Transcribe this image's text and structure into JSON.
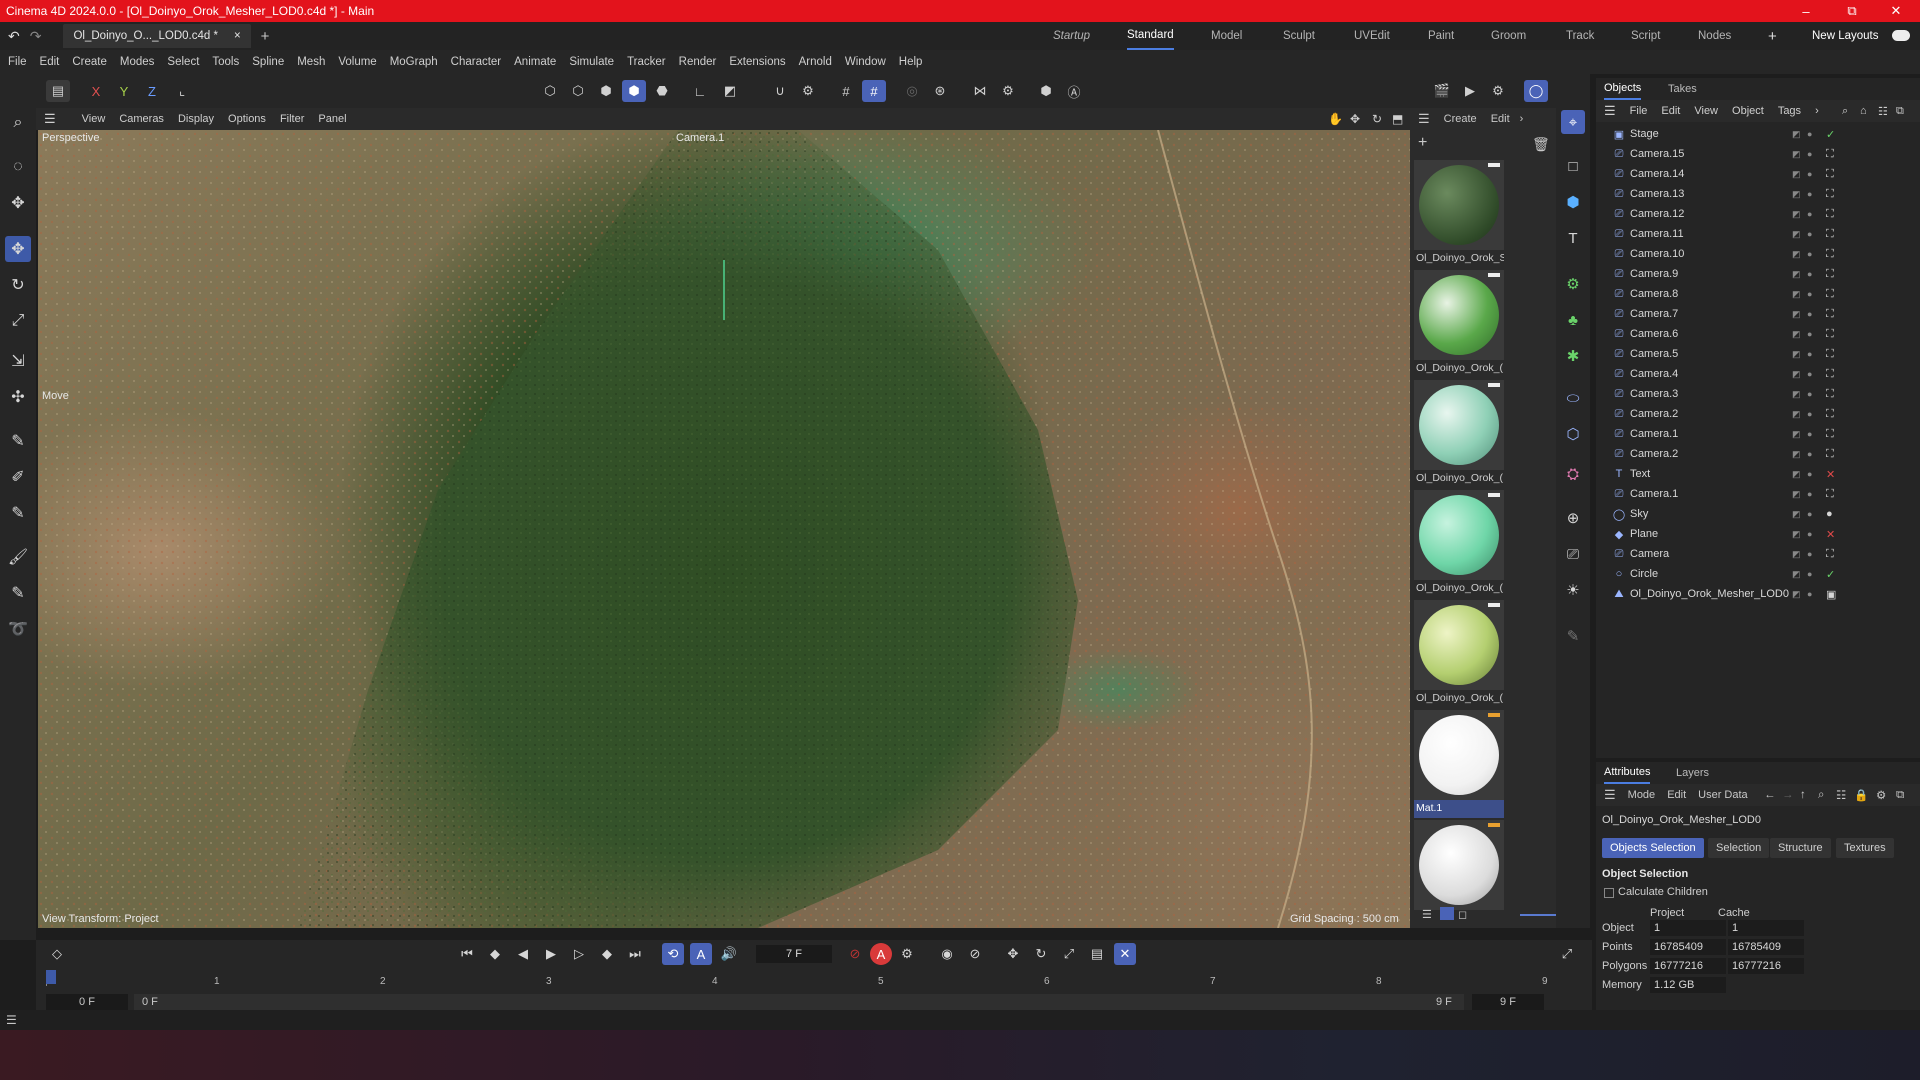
{
  "window": {
    "title": "Cinema 4D 2024.0.0 - [Ol_Doinyo_Orok_Mesher_LOD0.c4d *] - Main",
    "minimize": "–",
    "maximize": "⧉",
    "close": "✕"
  },
  "doc_tab": {
    "label": "Ol_Doinyo_O..._LOD0.c4d *",
    "close": "×",
    "add": "+"
  },
  "layouts": {
    "items": [
      "Startup",
      "Standard",
      "Model",
      "Sculpt",
      "UVEdit",
      "Paint",
      "Groom",
      "Track",
      "Script",
      "Nodes"
    ],
    "active": "Standard",
    "add": "+",
    "new_layouts": "New Layouts"
  },
  "menu": [
    "File",
    "Edit",
    "Create",
    "Modes",
    "Select",
    "Tools",
    "Spline",
    "Mesh",
    "Volume",
    "MoGraph",
    "Character",
    "Animate",
    "Simulate",
    "Tracker",
    "Render",
    "Extensions",
    "Arnold",
    "Window",
    "Help"
  ],
  "axes": {
    "x": "X",
    "y": "Y",
    "z": "Z"
  },
  "viewport": {
    "menu": [
      "View",
      "Cameras",
      "Display",
      "Options",
      "Filter",
      "Panel"
    ],
    "view_name": "Perspective",
    "camera": "Camera.1",
    "tool": "Move",
    "transform": "View Transform: Project",
    "grid": "Grid Spacing : 500 cm"
  },
  "materials": {
    "menu": [
      "Create",
      "Edit"
    ],
    "items": [
      {
        "name": "Ol_Doinyo_Orok_S",
        "color": "#3f5a36"
      },
      {
        "name": "Ol_Doinyo_Orok_(",
        "color": "#5aa84a"
      },
      {
        "name": "Ol_Doinyo_Orok_(",
        "color": "#8fd0b6"
      },
      {
        "name": "Ol_Doinyo_Orok_(",
        "color": "#6fd6a8"
      },
      {
        "name": "Ol_Doinyo_Orok_(",
        "color": "#b4cf70"
      },
      {
        "name": "Mat.1",
        "color": "#ffffff"
      },
      {
        "name": "",
        "color": "#e6e6e6"
      }
    ]
  },
  "objects_panel": {
    "tabs": [
      "Objects",
      "Takes"
    ],
    "menu": [
      "File",
      "Edit",
      "View",
      "Object",
      "Tags"
    ],
    "items": [
      {
        "name": "Stage",
        "icon": "stage-icon",
        "tag": "✓"
      },
      {
        "name": "Camera.15",
        "icon": "camera-icon",
        "tag": "⛶"
      },
      {
        "name": "Camera.14",
        "icon": "camera-icon",
        "tag": "⛶"
      },
      {
        "name": "Camera.13",
        "icon": "camera-icon",
        "tag": "⛶"
      },
      {
        "name": "Camera.12",
        "icon": "camera-icon",
        "tag": "⛶"
      },
      {
        "name": "Camera.11",
        "icon": "camera-icon",
        "tag": "⛶"
      },
      {
        "name": "Camera.10",
        "icon": "camera-icon",
        "tag": "⛶"
      },
      {
        "name": "Camera.9",
        "icon": "camera-icon",
        "tag": "⛶"
      },
      {
        "name": "Camera.8",
        "icon": "camera-icon",
        "tag": "⛶"
      },
      {
        "name": "Camera.7",
        "icon": "camera-icon",
        "tag": "⛶"
      },
      {
        "name": "Camera.6",
        "icon": "camera-icon",
        "tag": "⛶"
      },
      {
        "name": "Camera.5",
        "icon": "camera-icon",
        "tag": "⛶"
      },
      {
        "name": "Camera.4",
        "icon": "camera-icon",
        "tag": "⛶"
      },
      {
        "name": "Camera.3",
        "icon": "camera-icon",
        "tag": "⛶"
      },
      {
        "name": "Camera.2",
        "icon": "camera-icon",
        "tag": "⛶"
      },
      {
        "name": "Camera.1",
        "icon": "camera-icon",
        "tag": "⛶"
      },
      {
        "name": "Camera.2",
        "icon": "camera-icon",
        "tag": "⛶"
      },
      {
        "name": "Text",
        "icon": "text-icon",
        "tag": "✕"
      },
      {
        "name": "Camera.1",
        "icon": "camera-icon",
        "tag": "⛶"
      },
      {
        "name": "Sky",
        "icon": "sky-icon",
        "tag": "●"
      },
      {
        "name": "Plane",
        "icon": "plane-icon",
        "tag": "✕"
      },
      {
        "name": "Camera",
        "icon": "camera-icon",
        "tag": "⛶"
      },
      {
        "name": "Circle",
        "icon": "circle-icon",
        "tag": "✓"
      },
      {
        "name": "Ol_Doinyo_Orok_Mesher_LOD0",
        "icon": "mesh-icon",
        "tag": "▣"
      }
    ]
  },
  "attributes": {
    "tabs": [
      "Attributes",
      "Layers"
    ],
    "menu": [
      "Mode",
      "Edit",
      "User Data"
    ],
    "object_name": "Ol_Doinyo_Orok_Mesher_LOD0",
    "subtabs": [
      "Objects Selection",
      "Selection",
      "Structure",
      "Textures"
    ],
    "section": "Object Selection",
    "calc_children": "Calculate Children",
    "col_project": "Project",
    "col_cache": "Cache",
    "rows": [
      {
        "label": "Object",
        "project": "1",
        "cache": "1"
      },
      {
        "label": "Points",
        "project": "16785409",
        "cache": "16785409"
      },
      {
        "label": "Polygons",
        "project": "16777216",
        "cache": "16777216"
      },
      {
        "label": "Memory",
        "project": "1.12 GB",
        "cache": ""
      }
    ]
  },
  "timeline": {
    "current_frame": "7 F",
    "ticks": [
      "0",
      "1",
      "2",
      "3",
      "4",
      "5",
      "6",
      "7",
      "8",
      "9"
    ],
    "start": "0 F",
    "range_start": "0 F",
    "range_end": "9 F",
    "end": "9 F",
    "playhead_fraction": 0.0
  }
}
